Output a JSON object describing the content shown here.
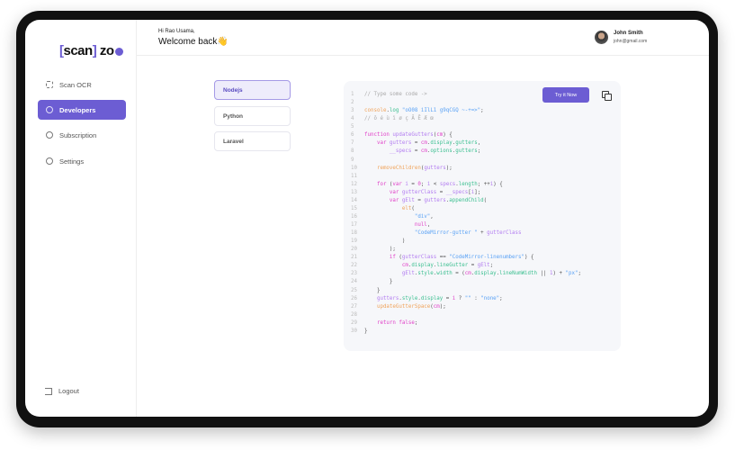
{
  "brand": {
    "logo_text": "scan zo"
  },
  "sidebar": {
    "items": [
      {
        "label": "Scan OCR",
        "icon": "scan-icon"
      },
      {
        "label": "Developers",
        "icon": "code-icon",
        "active": true
      },
      {
        "label": "Subscription",
        "icon": "dollar-icon"
      },
      {
        "label": "Settings",
        "icon": "gear-icon"
      }
    ],
    "logout": "Logout"
  },
  "header": {
    "greeting": "Hi Rao Usama,",
    "welcome": "Welcome back👋",
    "user_name": "John Smith",
    "user_email": "john@gmail.com"
  },
  "languages": [
    {
      "label": "Nodejs",
      "active": true
    },
    {
      "label": "Python"
    },
    {
      "label": "Laravel"
    }
  ],
  "code_panel": {
    "try_label": "Try it Now",
    "colors": {
      "accent": "#6c5dd3"
    },
    "lines": [
      [
        [
          "// Type some code ->",
          "c"
        ]
      ],
      [],
      [
        [
          "console",
          "f"
        ],
        [
          ".",
          "o"
        ],
        [
          "log",
          "p"
        ],
        [
          " \"oO08 iIlL1 g9qCGQ ~-+=>\"",
          "s"
        ],
        [
          ";",
          "o"
        ]
      ],
      [
        [
          "// ô é ù ï ø ç Ã Ē Æ œ",
          "c"
        ]
      ],
      [],
      [
        [
          "function",
          "k"
        ],
        [
          " updateGutters",
          "v"
        ],
        [
          "(",
          "o"
        ],
        [
          "cm",
          "k"
        ],
        [
          ") {",
          "o"
        ]
      ],
      [
        [
          "    var",
          "k"
        ],
        [
          " gutters",
          "v"
        ],
        [
          " = ",
          "o"
        ],
        [
          "cm",
          "k"
        ],
        [
          ".",
          "o"
        ],
        [
          "display",
          "p"
        ],
        [
          ".",
          "o"
        ],
        [
          "gutters",
          "p"
        ],
        [
          ",",
          "o"
        ]
      ],
      [
        [
          "        __specs",
          "v"
        ],
        [
          " = ",
          "o"
        ],
        [
          "cm",
          "k"
        ],
        [
          ".",
          "o"
        ],
        [
          "options",
          "p"
        ],
        [
          ".",
          "o"
        ],
        [
          "gutters",
          "p"
        ],
        [
          ";",
          "o"
        ]
      ],
      [],
      [
        [
          "    removeChildren",
          "f"
        ],
        [
          "(",
          "o"
        ],
        [
          "gutters",
          "v"
        ],
        [
          ");",
          "o"
        ]
      ],
      [],
      [
        [
          "    for",
          "k"
        ],
        [
          " (",
          "o"
        ],
        [
          "var",
          "k"
        ],
        [
          " i",
          "v"
        ],
        [
          " = ",
          "o"
        ],
        [
          "0",
          "k"
        ],
        [
          "; ",
          "o"
        ],
        [
          "i",
          "v"
        ],
        [
          " < ",
          "o"
        ],
        [
          "specs",
          "v"
        ],
        [
          ".",
          "o"
        ],
        [
          "length",
          "p"
        ],
        [
          "; ++",
          "o"
        ],
        [
          "i",
          "v"
        ],
        [
          ") {",
          "o"
        ]
      ],
      [
        [
          "        var",
          "k"
        ],
        [
          " gutterClass",
          "v"
        ],
        [
          " = ",
          "o"
        ],
        [
          "__specs",
          "v"
        ],
        [
          "[",
          "o"
        ],
        [
          "i",
          "v"
        ],
        [
          "];",
          "o"
        ]
      ],
      [
        [
          "        var",
          "k"
        ],
        [
          " gElt",
          "v"
        ],
        [
          " = ",
          "o"
        ],
        [
          "gutters",
          "v"
        ],
        [
          ".",
          "o"
        ],
        [
          "appendChild",
          "p"
        ],
        [
          "(",
          "o"
        ]
      ],
      [
        [
          "            elt",
          "f"
        ],
        [
          "(",
          "o"
        ]
      ],
      [
        [
          "                \"div\"",
          "s"
        ],
        [
          ",",
          "o"
        ]
      ],
      [
        [
          "                null",
          "k"
        ],
        [
          ",",
          "o"
        ]
      ],
      [
        [
          "                \"CodeMirror-gutter \"",
          "s"
        ],
        [
          " + ",
          "o"
        ],
        [
          "gutterClass",
          "v"
        ]
      ],
      [
        [
          "            )",
          "o"
        ]
      ],
      [
        [
          "        );",
          "o"
        ]
      ],
      [
        [
          "        if",
          "k"
        ],
        [
          " (",
          "o"
        ],
        [
          "gutterClass",
          "v"
        ],
        [
          " == ",
          "o"
        ],
        [
          "\"CodeMirror-linenumbers\"",
          "s"
        ],
        [
          ") {",
          "o"
        ]
      ],
      [
        [
          "            cm",
          "k"
        ],
        [
          ".",
          "o"
        ],
        [
          "display",
          "p"
        ],
        [
          ".",
          "o"
        ],
        [
          "lineGutter",
          "p"
        ],
        [
          " = ",
          "o"
        ],
        [
          "gElt",
          "v"
        ],
        [
          ";",
          "o"
        ]
      ],
      [
        [
          "            gElt",
          "v"
        ],
        [
          ".",
          "o"
        ],
        [
          "style",
          "p"
        ],
        [
          ".",
          "o"
        ],
        [
          "width",
          "p"
        ],
        [
          " = (",
          "o"
        ],
        [
          "cm",
          "k"
        ],
        [
          ".",
          "o"
        ],
        [
          "display",
          "p"
        ],
        [
          ".",
          "o"
        ],
        [
          "lineNumWidth",
          "p"
        ],
        [
          " || ",
          "o"
        ],
        [
          "1",
          "v"
        ],
        [
          ") + ",
          "o"
        ],
        [
          "\"px\"",
          "s"
        ],
        [
          ";",
          "o"
        ]
      ],
      [
        [
          "        }",
          "o"
        ]
      ],
      [
        [
          "    }",
          "o"
        ]
      ],
      [
        [
          "    gutters",
          "v"
        ],
        [
          ".",
          "o"
        ],
        [
          "style",
          "p"
        ],
        [
          ".",
          "o"
        ],
        [
          "display",
          "p"
        ],
        [
          " = ",
          "o"
        ],
        [
          "i",
          "k"
        ],
        [
          " ? ",
          "o"
        ],
        [
          "\"\"",
          "s"
        ],
        [
          " : ",
          "o"
        ],
        [
          "\"none\"",
          "s"
        ],
        [
          ";",
          "o"
        ]
      ],
      [
        [
          "    updateGutterSpace",
          "f"
        ],
        [
          "(",
          "o"
        ],
        [
          "cm",
          "k"
        ],
        [
          ");",
          "o"
        ]
      ],
      [],
      [
        [
          "    return",
          "k"
        ],
        [
          " false",
          "k"
        ],
        [
          ";",
          "o"
        ]
      ],
      [
        [
          "}",
          "o"
        ]
      ]
    ]
  }
}
